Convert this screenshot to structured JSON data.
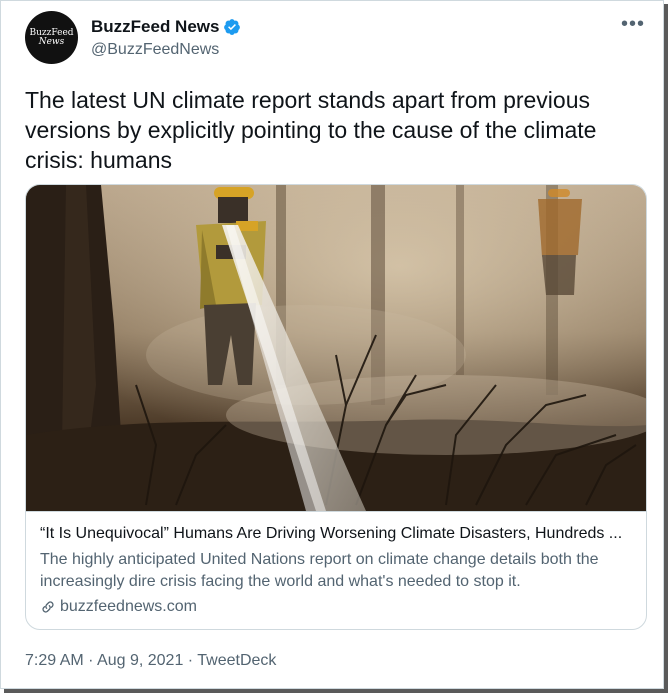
{
  "account": {
    "display_name": "BuzzFeed News",
    "handle": "@BuzzFeedNews",
    "avatar_text_line1": "BuzzFeed",
    "avatar_text_line2": "News",
    "verified_icon": "verified-badge-icon"
  },
  "more_label": "•••",
  "tweet": {
    "text": "The latest UN climate report stands apart from previous versions by explicitly pointing to the cause of the climate crisis: humans"
  },
  "card": {
    "title": "“It Is Unequivocal” Humans Are Driving Worsening Climate Disasters, Hundreds ...",
    "description": "The highly anticipated United Nations report on climate change details both the increasingly dire crisis facing the world and what's needed to stop it.",
    "domain": "buzzfeednews.com",
    "image_subject": "firefighters-spraying-water-on-smoky-forest-photo"
  },
  "meta": {
    "footer": "7:29 AM · Aug 9, 2021 · TweetDeck"
  },
  "colors": {
    "text": "#0f1419",
    "secondary": "#536471",
    "border": "#cfd9de",
    "verified": "#1d9bf0"
  }
}
